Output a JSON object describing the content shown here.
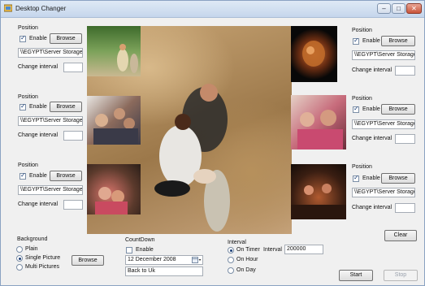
{
  "window": {
    "title": "Desktop Changer",
    "minimize": "–",
    "maximize": "□",
    "close": "✕"
  },
  "panels": {
    "top_left": {
      "title": "Position",
      "enable_label": "Enable",
      "enabled": true,
      "browse_label": "Browse",
      "path": "\\\\EGYPT\\Server Storage",
      "interval_label": "Change interval",
      "interval_value": ""
    },
    "mid_left": {
      "title": "Position",
      "enable_label": "Enable",
      "enabled": true,
      "browse_label": "Browse",
      "path": "\\\\EGYPT\\Server Storage",
      "interval_label": "Change interval",
      "interval_value": ""
    },
    "bottom_left": {
      "title": "Position",
      "enable_label": "Enable",
      "enabled": true,
      "browse_label": "Browse",
      "path": "\\\\EGYPT\\Server Storage",
      "interval_label": "Change interval",
      "interval_value": ""
    },
    "top_right": {
      "title": "Position",
      "enable_label": "Enable",
      "enabled": true,
      "browse_label": "Browse",
      "path": "\\\\EGYPT\\Server Storage",
      "interval_label": "Change interval",
      "interval_value": ""
    },
    "mid_right": {
      "title": "Position",
      "enable_label": "Enable",
      "enabled": true,
      "browse_label": "Browse",
      "path": "\\\\EGYPT\\Server Storage",
      "interval_label": "Change interval",
      "interval_value": ""
    },
    "bottom_right": {
      "title": "Position",
      "enable_label": "Enable",
      "enabled": true,
      "browse_label": "Browse",
      "path": "\\\\EGYPT\\Server Storage",
      "interval_label": "Change interval",
      "interval_value": ""
    }
  },
  "clear_label": "Clear",
  "background": {
    "title": "Background",
    "options": [
      "Plain",
      "Single Picture",
      "Multi Pictures"
    ],
    "selected": "Single Picture",
    "browse_label": "Browse"
  },
  "countdown": {
    "title": "CountDown",
    "enable_label": "Enable",
    "enabled": false,
    "date": "12 December 2008",
    "message": "Back to Uk"
  },
  "interval": {
    "title": "Interval",
    "options": [
      "On Timer",
      "On Hour",
      "On Day"
    ],
    "selected": "On Timer",
    "interval_label": "Interval",
    "interval_value": "200000"
  },
  "start_label": "Start",
  "stop_label": "Stop",
  "icons": {
    "app": "app-icon",
    "calendar": "calendar-dropdown-icon"
  }
}
